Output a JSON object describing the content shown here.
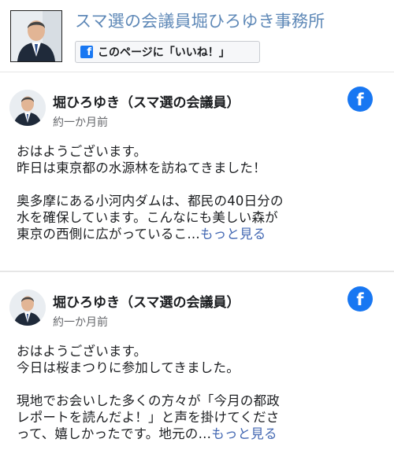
{
  "header": {
    "title": "スマ選の会議員堀ひろゆき事務所",
    "like_button_label": "このページに「いいね！」",
    "fb_glyph": "f"
  },
  "posts": [
    {
      "author": "堀ひろゆき（スマ選の会議員）",
      "time": "約一か月前",
      "fb_glyph": "f",
      "body_lines": [
        "おはようございます。",
        "昨日は東京都の水源林を訪ねてきました！",
        "",
        "奥多摩にある小河内ダムは、都民の40日分の",
        "水を確保しています。こんなにも美しい森が",
        "東京の西側に広がっているこ…"
      ],
      "see_more": "もっと見る"
    },
    {
      "author": "堀ひろゆき（スマ選の会議員）",
      "time": "約一か月前",
      "fb_glyph": "f",
      "body_lines": [
        "おはようございます。",
        "今日は桜まつりに参加してきました。",
        "",
        "現地でお会いした多くの方々が「今月の都政",
        "レポートを読んだよ！」と声を掛けてくださ",
        "って、嬉しかったです。地元の…"
      ],
      "see_more": "もっと見る"
    }
  ],
  "icons": {
    "facebook": "facebook-icon",
    "avatar": "person-avatar-photo"
  },
  "colors": {
    "title": "#5e88b7",
    "facebook_blue": "#1877f2",
    "link": "#4267b2",
    "meta_text": "#65676b"
  }
}
